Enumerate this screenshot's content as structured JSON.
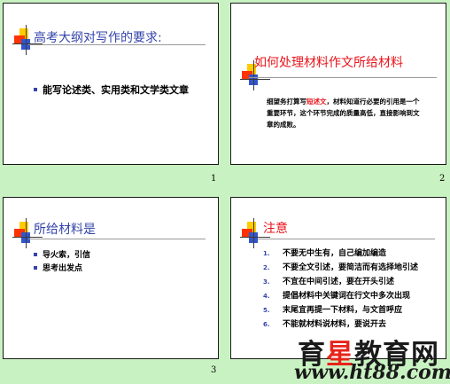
{
  "slides": [
    {
      "number": "1",
      "title": "高考大纲对写作的要求:",
      "bullets": [
        "能写论述类、实用类和文学类文章"
      ]
    },
    {
      "number": "2",
      "title": "如何处理材料作文所给材料",
      "paragraph": {
        "part1": "细望务打算写",
        "highlight": "短述文",
        "part2": "，材料知道行必要的引用是一个重要环节，这个环节完成的质量高低，直接影响到文章的成败。"
      }
    },
    {
      "number": "3",
      "title": "所给材料是",
      "bullets": [
        "导火索，引信",
        "思考出发点"
      ]
    },
    {
      "number": "",
      "title": "注意",
      "items": [
        {
          "n": "1.",
          "text": "不要无中生有，自己编加编造"
        },
        {
          "n": "2.",
          "text": "不要全文引述，要简洁而有选择地引述"
        },
        {
          "n": "3.",
          "text": "不宜在中间引述，要在开头引述"
        },
        {
          "n": "4.",
          "text": "提倡材料中关键词在行文中多次出现"
        },
        {
          "n": "5.",
          "text": "末尾宜再提一下材料，与文首呼应"
        },
        {
          "n": "6.",
          "text": "不能就材料说材料，要说开去"
        }
      ]
    }
  ],
  "watermark": {
    "part1": "育",
    "star": "星",
    "part2": "教育网",
    "url": "www.ht88.com"
  }
}
